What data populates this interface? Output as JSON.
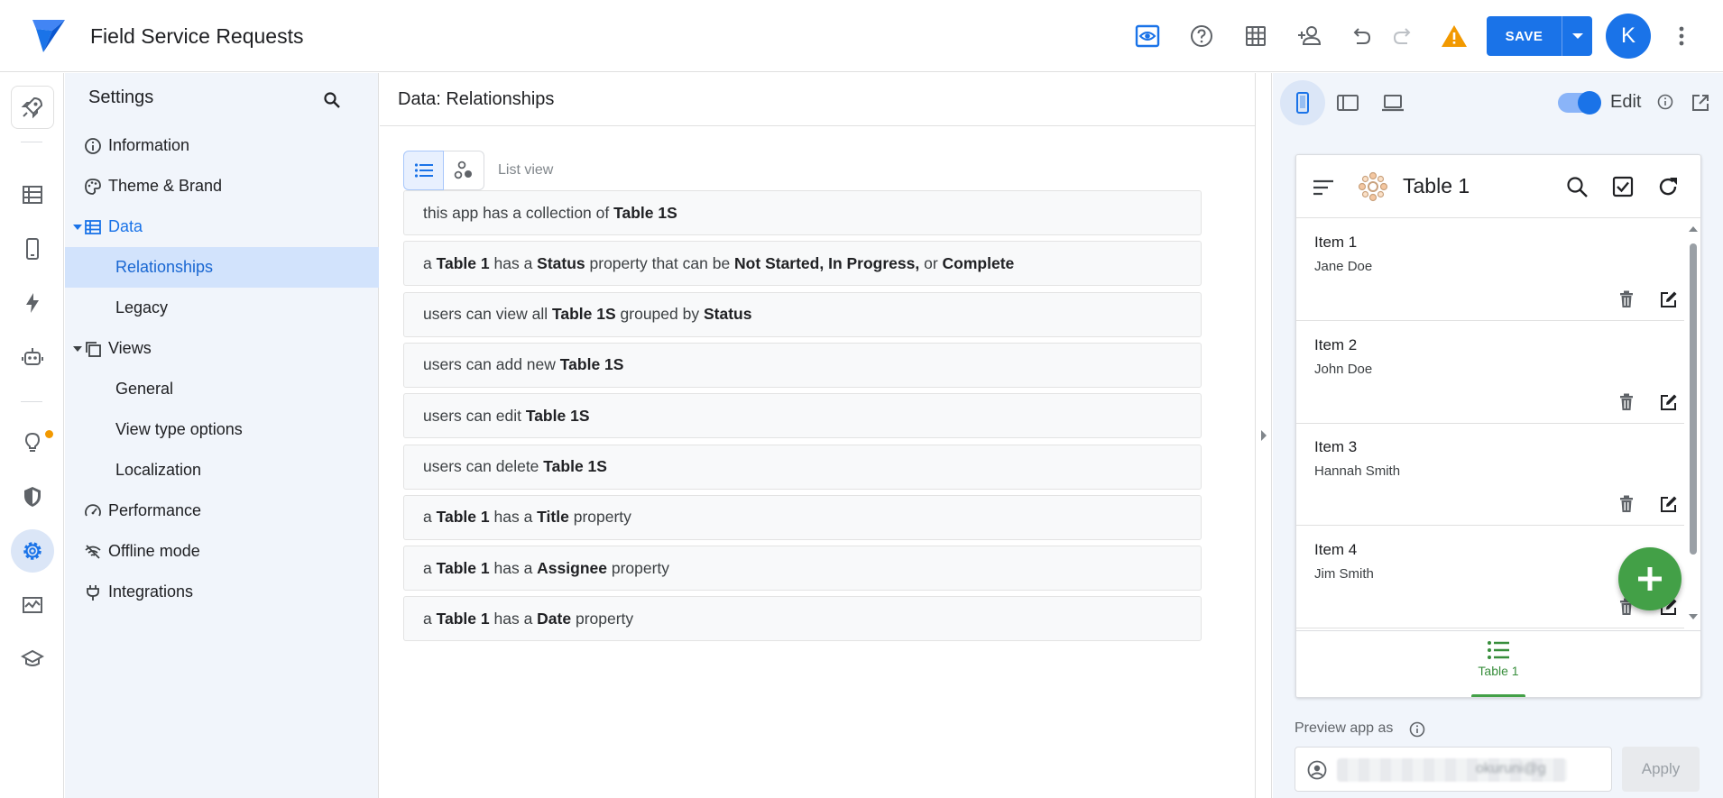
{
  "header": {
    "app_title": "Field Service Requests",
    "save_label": "SAVE",
    "avatar_letter": "K"
  },
  "settings": {
    "title": "Settings",
    "items": [
      {
        "label": "Information",
        "icon": "info-icon"
      },
      {
        "label": "Theme & Brand",
        "icon": "palette-icon"
      },
      {
        "label": "Data",
        "icon": "table-icon"
      },
      {
        "label": "Relationships"
      },
      {
        "label": "Legacy"
      },
      {
        "label": "Views",
        "icon": "views-icon"
      },
      {
        "label": "General"
      },
      {
        "label": "View type options"
      },
      {
        "label": "Localization"
      },
      {
        "label": "Performance",
        "icon": "speedometer-icon"
      },
      {
        "label": "Offline mode",
        "icon": "wifi-off-icon"
      },
      {
        "label": "Integrations",
        "icon": "plug-icon"
      }
    ]
  },
  "main": {
    "title": "Data: Relationships",
    "list_view_label": "List view",
    "relationships": [
      [
        {
          "t": "this app has a collection of "
        },
        {
          "t": "Table 1S",
          "b": true
        }
      ],
      [
        {
          "t": "a "
        },
        {
          "t": "Table 1",
          "b": true
        },
        {
          "t": " has a "
        },
        {
          "t": "Status",
          "b": true
        },
        {
          "t": " property that can be "
        },
        {
          "t": "Not Started, In Progress,",
          "b": true
        },
        {
          "t": " or "
        },
        {
          "t": "Complete",
          "b": true
        }
      ],
      [
        {
          "t": "users can view all "
        },
        {
          "t": "Table 1S",
          "b": true
        },
        {
          "t": " grouped by "
        },
        {
          "t": "Status",
          "b": true
        }
      ],
      [
        {
          "t": "users can add new "
        },
        {
          "t": "Table 1S",
          "b": true
        }
      ],
      [
        {
          "t": "users can edit "
        },
        {
          "t": "Table 1S",
          "b": true
        }
      ],
      [
        {
          "t": "users can delete "
        },
        {
          "t": "Table 1S",
          "b": true
        }
      ],
      [
        {
          "t": "a "
        },
        {
          "t": "Table 1",
          "b": true
        },
        {
          "t": " has a "
        },
        {
          "t": "Title",
          "b": true
        },
        {
          "t": " property"
        }
      ],
      [
        {
          "t": "a "
        },
        {
          "t": "Table 1",
          "b": true
        },
        {
          "t": " has a "
        },
        {
          "t": "Assignee",
          "b": true
        },
        {
          "t": " property"
        }
      ],
      [
        {
          "t": "a "
        },
        {
          "t": "Table 1",
          "b": true
        },
        {
          "t": " has a "
        },
        {
          "t": "Date",
          "b": true
        },
        {
          "t": " property"
        }
      ]
    ]
  },
  "preview": {
    "edit_label": "Edit",
    "phone_title": "Table 1",
    "items": [
      {
        "title": "Item 1",
        "subtitle": "Jane Doe"
      },
      {
        "title": "Item 2",
        "subtitle": "John Doe"
      },
      {
        "title": "Item 3",
        "subtitle": "Hannah Smith"
      },
      {
        "title": "Item 4",
        "subtitle": "Jim Smith"
      }
    ],
    "bottom_tab_label": "Table 1",
    "preview_as_label": "Preview app as",
    "user_value": "okuruni@g",
    "apply_label": "Apply"
  },
  "colors": {
    "accent": "#1a73e8",
    "selected_bg": "#d2e3fc",
    "fab": "#43a047",
    "warning": "#f29900"
  }
}
